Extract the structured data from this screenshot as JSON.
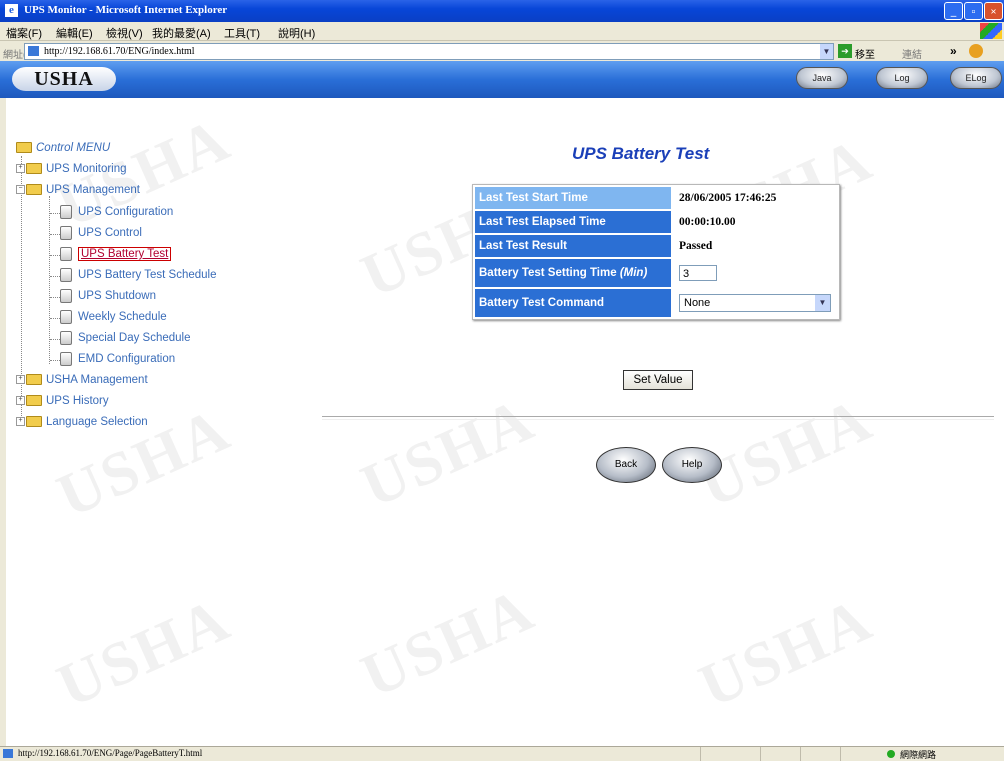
{
  "window": {
    "title": "UPS Monitor - Microsoft Internet Explorer"
  },
  "menu": [
    "檔案(F)",
    "編輯(E)",
    "檢視(V)",
    "我的最愛(A)",
    "工具(T)",
    "說明(H)"
  ],
  "address": {
    "label": "網址(D)",
    "url": "http://192.168.61.70/ENG/index.html",
    "go_label": "移至",
    "links_label": "連結",
    "chevron": "»"
  },
  "header": {
    "logo": "USHA",
    "buttons": [
      "Java",
      "Log",
      "ELog"
    ]
  },
  "tree": {
    "root": "Control MENU",
    "items": [
      "UPS Monitoring",
      "UPS Management",
      "UPS Configuration",
      "UPS Control",
      "UPS Battery Test",
      "UPS Battery Test Schedule",
      "UPS Shutdown",
      "Weekly Schedule",
      "Special Day Schedule",
      "EMD Configuration",
      "USHA Management",
      "UPS History",
      "Language Selection"
    ]
  },
  "main": {
    "title": "UPS Battery Test",
    "rows": [
      {
        "label": "Last Test Start Time",
        "value": "28/06/2005 17:46:25"
      },
      {
        "label": "Last Test Elapsed Time",
        "value": "00:00:10.00"
      },
      {
        "label": "Last Test Result",
        "value": "Passed"
      }
    ],
    "setting": {
      "label": "Battery Test Setting Time ",
      "unit": "(Min)",
      "value": "3"
    },
    "command": {
      "label": "Battery Test Command",
      "selected": "None"
    },
    "set_button": "Set Value",
    "back_button": "Back",
    "help_button": "Help"
  },
  "statusbar": {
    "url": "http://192.168.61.70/ENG/Page/PageBatteryT.html",
    "zone": "網際網路"
  },
  "watermark": "USHA",
  "colors": {
    "accent": "#2b6fd4",
    "title": "#1a3fb8",
    "tree_text": "#3a6cb8"
  }
}
